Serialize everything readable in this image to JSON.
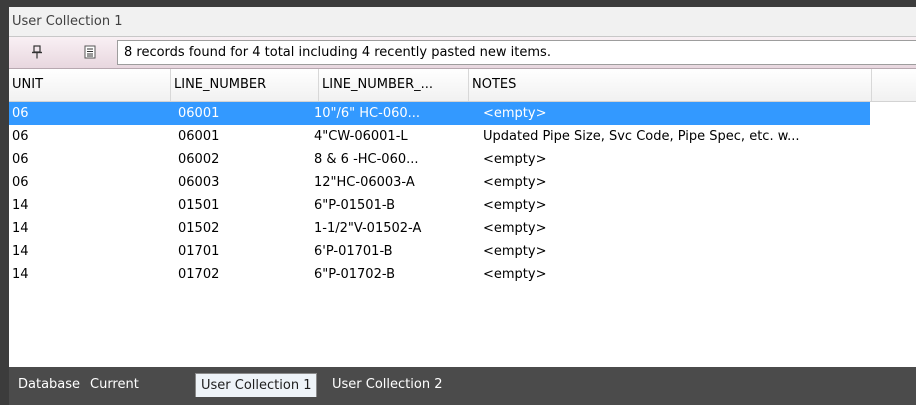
{
  "panel": {
    "title": "User Collection 1"
  },
  "toolbar": {
    "pin_icon": "pin-icon",
    "menu_icon": "list-menu-icon",
    "status_text": "8 records found for 4 total including 4 recently pasted new items."
  },
  "grid": {
    "columns": [
      "UNIT",
      "LINE_NUMBER",
      "LINE_NUMBER_...",
      "NOTES"
    ],
    "rows": [
      {
        "unit": "06",
        "line_number": "06001",
        "line_number_full": "10\"/6\" HC-060...",
        "notes": "<empty>",
        "selected": true
      },
      {
        "unit": "06",
        "line_number": "06001",
        "line_number_full": "4\"CW-06001-L",
        "notes": "Updated Pipe Size, Svc Code, Pipe Spec, etc. w...",
        "selected": false
      },
      {
        "unit": "06",
        "line_number": "06002",
        "line_number_full": "8 & 6 -HC-060...",
        "notes": "<empty>",
        "selected": false
      },
      {
        "unit": "06",
        "line_number": "06003",
        "line_number_full": "12\"HC-06003-A",
        "notes": "<empty>",
        "selected": false
      },
      {
        "unit": "14",
        "line_number": "01501",
        "line_number_full": "6\"P-01501-B",
        "notes": "<empty>",
        "selected": false
      },
      {
        "unit": "14",
        "line_number": "01502",
        "line_number_full": "1-1/2\"V-01502-A",
        "notes": "<empty>",
        "selected": false
      },
      {
        "unit": "14",
        "line_number": "01701",
        "line_number_full": "6'P-01701-B",
        "notes": "<empty>",
        "selected": false
      },
      {
        "unit": "14",
        "line_number": "01702",
        "line_number_full": "6\"P-01702-B",
        "notes": "<empty>",
        "selected": false
      }
    ],
    "selection_color": "#3399ff"
  },
  "tabs": [
    {
      "label": "Database",
      "active": false
    },
    {
      "label": "Current",
      "active": false
    },
    {
      "label": "User Collection 1",
      "active": true
    },
    {
      "label": "User Collection 2",
      "active": false
    }
  ]
}
